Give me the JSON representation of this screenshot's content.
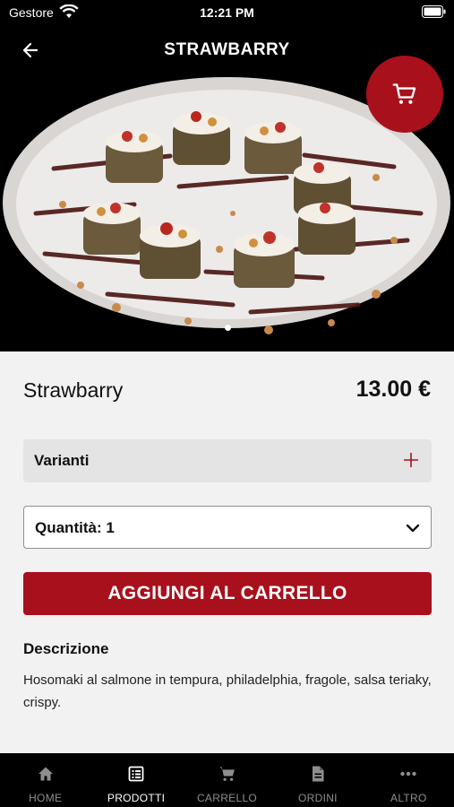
{
  "status_bar": {
    "carrier": "Gestore",
    "time": "12:21 PM"
  },
  "header": {
    "title": "STRAWBARRY"
  },
  "product": {
    "name": "Strawbarry",
    "price": "13.00 €"
  },
  "variants": {
    "label": "Varianti"
  },
  "quantity": {
    "label": "Quantità: 1"
  },
  "add_to_cart": {
    "label": "AGGIUNGI AL CARRELLO"
  },
  "description": {
    "heading": "Descrizione",
    "text": "Hosomaki al salmone in tempura, philadelphia, fragole, salsa teriaky, crispy."
  },
  "tabs": [
    {
      "label": "HOME",
      "icon": "home-icon"
    },
    {
      "label": "PRODOTTI",
      "icon": "list-icon"
    },
    {
      "label": "CARRELLO",
      "icon": "cart-icon"
    },
    {
      "label": "ORDINI",
      "icon": "document-icon"
    },
    {
      "label": "ALTRO",
      "icon": "more-icon"
    }
  ],
  "active_tab": 1,
  "colors": {
    "accent": "#a8101c",
    "background": "#f2f2f2",
    "bar": "#000000"
  }
}
